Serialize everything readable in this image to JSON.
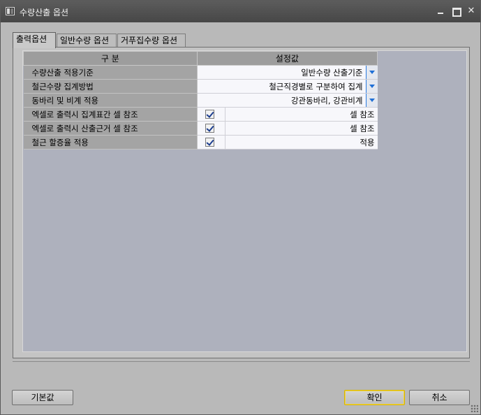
{
  "window": {
    "title": "수량산출 옵션"
  },
  "tabs": [
    {
      "label": "출력옵션",
      "active": true
    },
    {
      "label": "일반수량 옵션",
      "active": false
    },
    {
      "label": "거푸집수량 옵션",
      "active": false
    }
  ],
  "grid": {
    "headers": {
      "col1": "구 분",
      "col2": "설정값"
    },
    "rows": [
      {
        "label": "수량산출 적용기준",
        "type": "combo",
        "value": "일반수량 산출기준"
      },
      {
        "label": "철근수량 집계방법",
        "type": "combo",
        "value": "철근직경별로 구분하여 집계"
      },
      {
        "label": "동바리 및 비계 적용",
        "type": "combo",
        "value": "강관동바리, 강관비계"
      },
      {
        "label": "엑셀로 출력시 집계표간 셀 참조",
        "type": "checkbox",
        "checked": true,
        "value": "셀 참조"
      },
      {
        "label": "엑셀로 출력시 산출근거 셀 참조",
        "type": "checkbox",
        "checked": true,
        "value": "셀 참조"
      },
      {
        "label": "철근 할증율 적용",
        "type": "checkbox",
        "checked": true,
        "value": "적용"
      }
    ]
  },
  "buttons": {
    "default_label": "기본값",
    "ok_label": "확인",
    "cancel_label": "취소"
  },
  "colors": {
    "titlebar": "#4f4f4f",
    "panel": "#b9b9b9",
    "grid_empty": "#aeb1bd",
    "combo_accent": "#1f6fd6",
    "focus_border": "#d6b400"
  }
}
